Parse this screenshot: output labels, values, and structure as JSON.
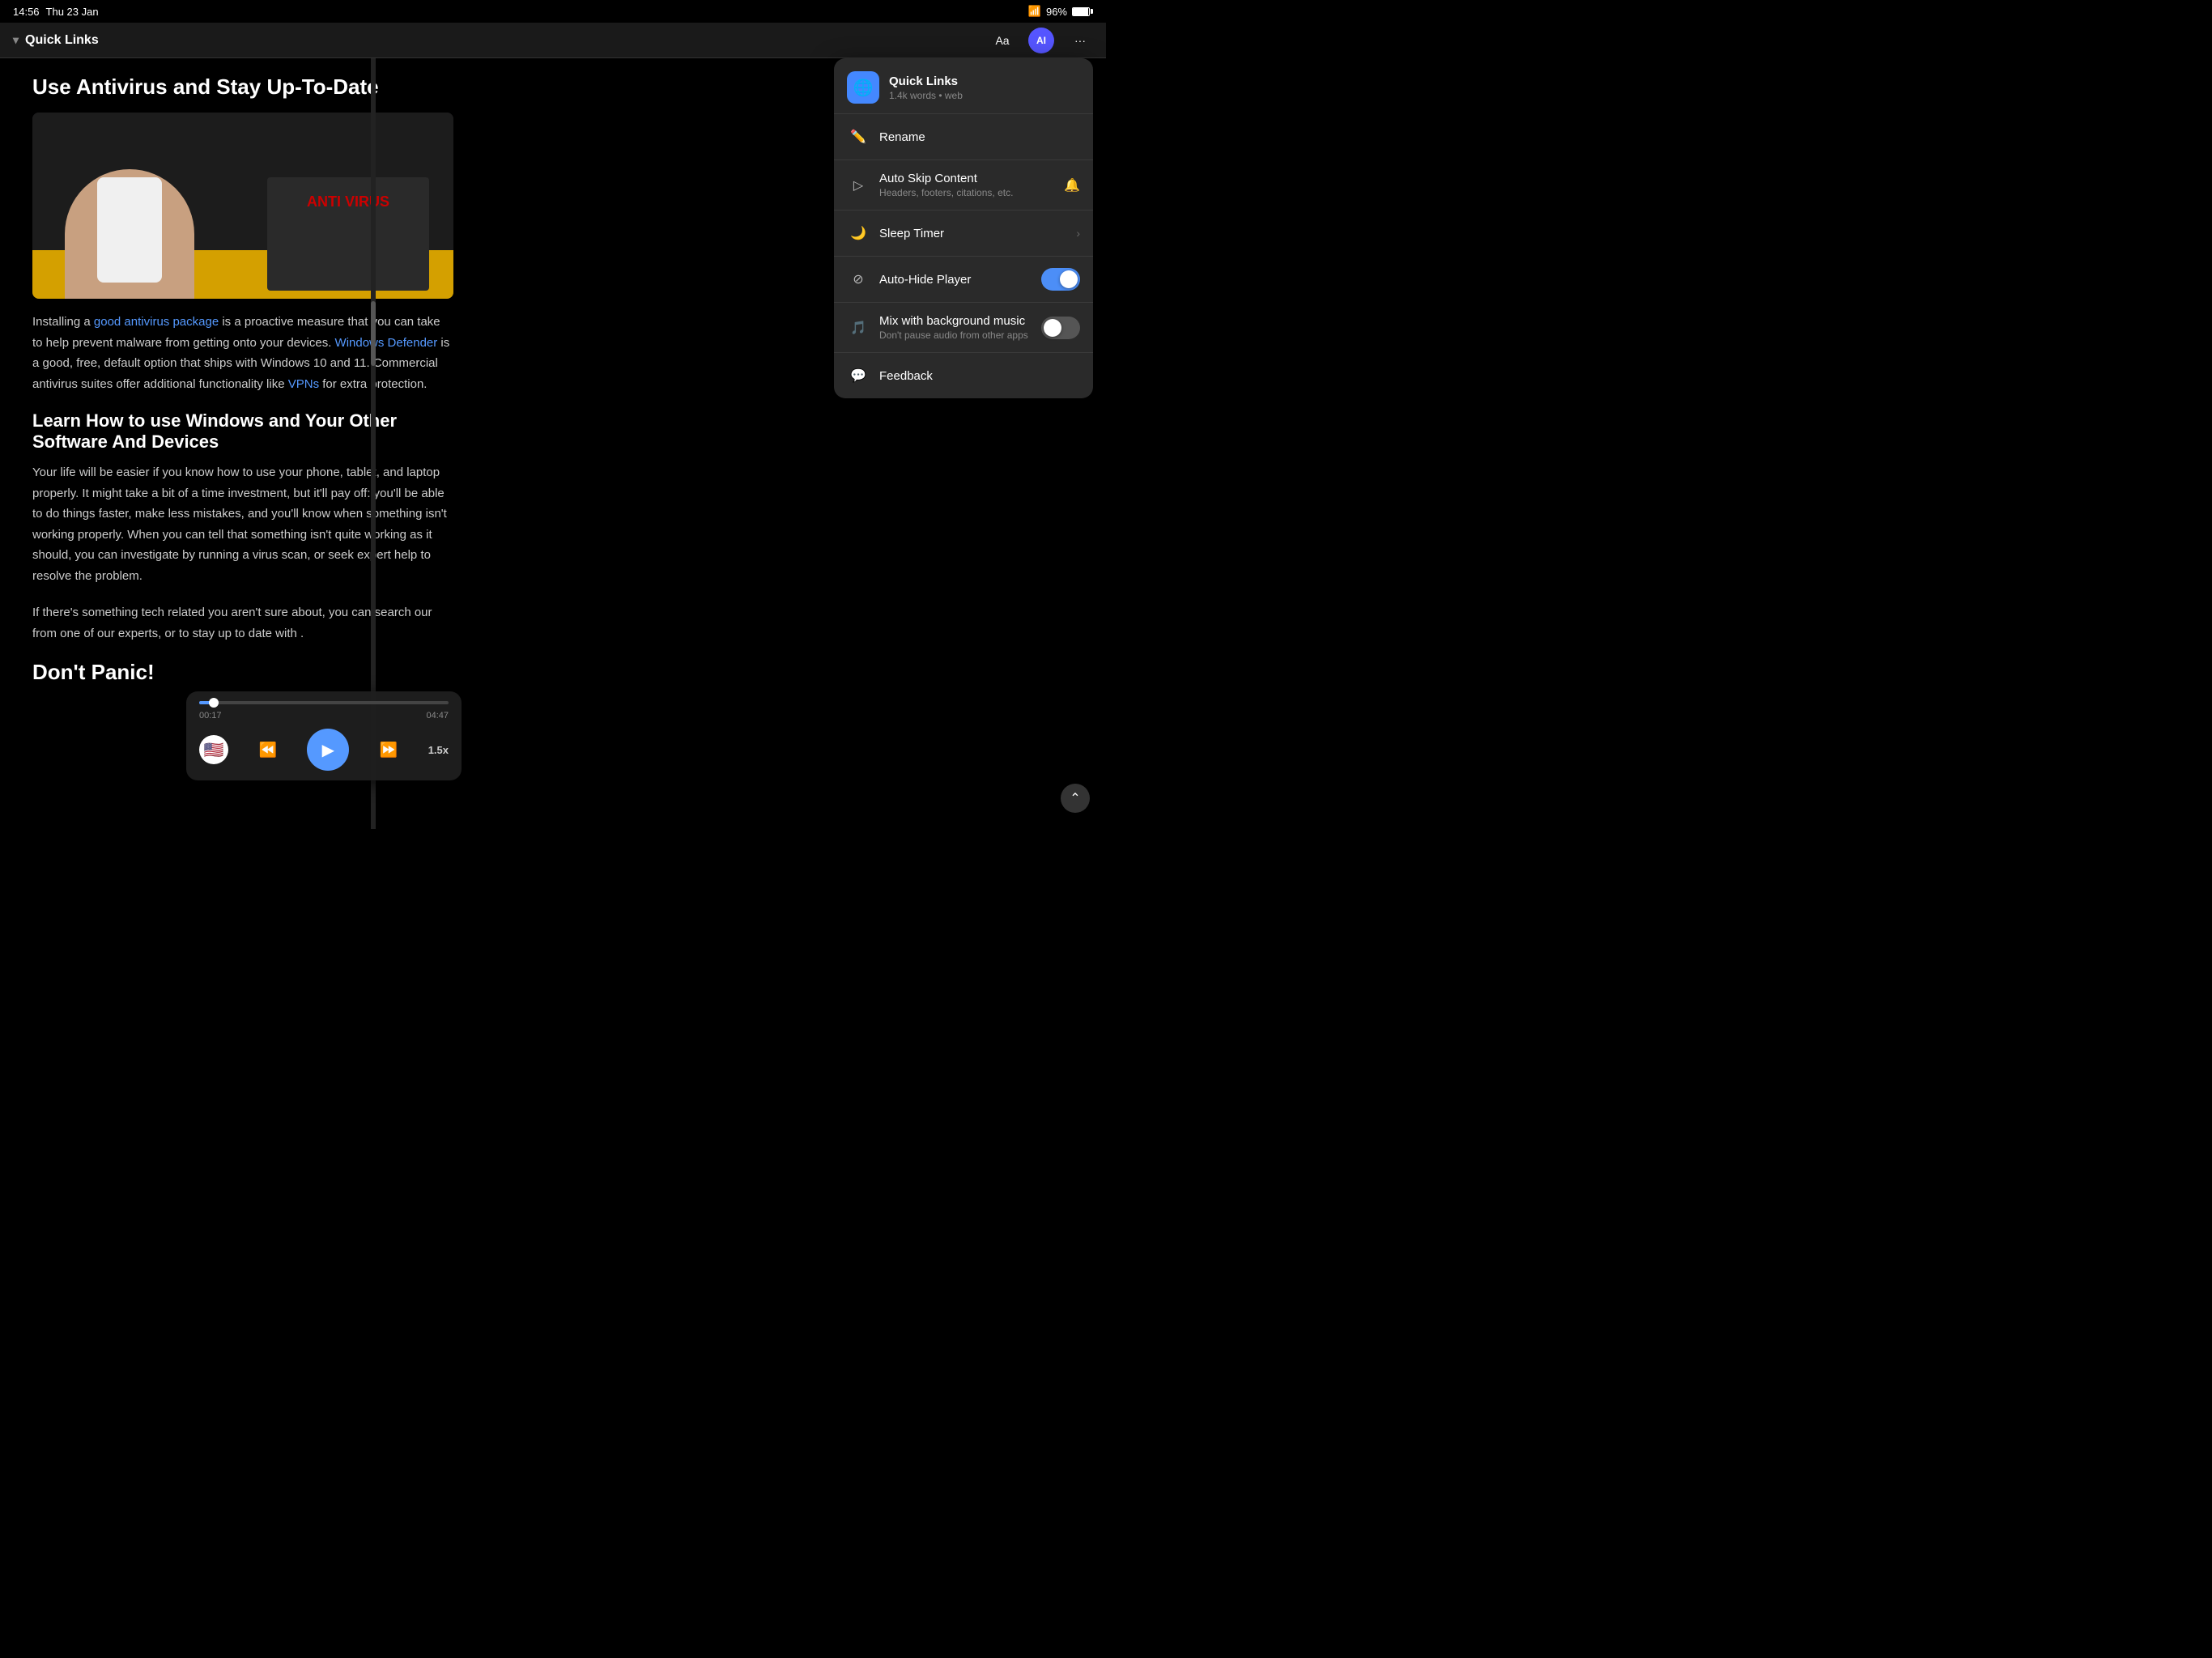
{
  "status_bar": {
    "time": "14:56",
    "date": "Thu 23 Jan",
    "wifi": "wifi",
    "battery": "96%"
  },
  "nav": {
    "chevron": "▾",
    "title": "Quick Links",
    "aa_btn": "Aa",
    "ai_btn": "AI",
    "more_btn": "···"
  },
  "article": {
    "heading1": "Use Antivirus and Stay Up-To-Date",
    "body1_part1": "Installing a ",
    "link1": "good antivirus package",
    "body1_part2": " is a proactive measure that you can take to help prevent malware from getting onto your devices. ",
    "link2": "Windows Defender",
    "body1_part3": " is a good, free, default option that ships with Windows 10 and 11. Commercial antivirus suites offer additional functionality like ",
    "link3": "VPNs",
    "body1_part4": " for extra protection.",
    "heading2": "Learn How to use Windows and Your Other Software And Devices",
    "body2": "Your life will be easier if you know how to use your phone, tablet, and laptop properly. It might take a bit of a time investment, but it'll pay off: you'll be able to do things faster, make less mistakes, and you'll know when something isn't working properly. When you can tell that something isn't quite working as it should, you can investigate by running a virus scan, or seek expert help to resolve the problem.",
    "body3_part1": "If there's something tech related you aren't sure about, you can search our ",
    "body3_part2": " from one of our experts, or ",
    "body3_part3": " to stay up to date with ",
    "body3_part4": ".",
    "heading3": "Don't Panic!"
  },
  "dropdown": {
    "app_name": "Quick Links",
    "app_meta": "1.4k words • web",
    "items": [
      {
        "id": "rename",
        "icon": "✏️",
        "label": "Rename",
        "sublabel": "",
        "right_type": "none"
      },
      {
        "id": "auto-skip",
        "icon": "▷",
        "label": "Auto Skip Content",
        "sublabel": "Headers, footers, citations, etc.",
        "right_type": "bell"
      },
      {
        "id": "sleep-timer",
        "icon": "🌙",
        "label": "Sleep Timer",
        "sublabel": "",
        "right_type": "chevron"
      },
      {
        "id": "auto-hide",
        "icon": "⊘",
        "label": "Auto-Hide Player",
        "sublabel": "",
        "right_type": "toggle-on"
      },
      {
        "id": "mix-music",
        "icon": "🎵",
        "label": "Mix with background music",
        "sublabel": "Don't pause audio from other apps",
        "right_type": "toggle-off"
      },
      {
        "id": "feedback",
        "icon": "💬",
        "label": "Feedback",
        "sublabel": "",
        "right_type": "none"
      }
    ]
  },
  "player": {
    "current_time": "00:17",
    "total_time": "04:47",
    "progress_percent": 6,
    "speed": "1.5x",
    "flag": "🇺🇸"
  },
  "icons": {
    "play": "▶",
    "rewind": "⏪",
    "forward": "⏩",
    "chevron_up": "⌃",
    "globe": "🌐",
    "bell": "🔔"
  }
}
